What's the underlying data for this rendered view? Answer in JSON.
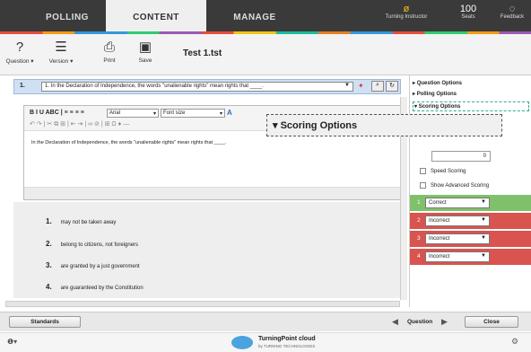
{
  "nav": {
    "tabs": [
      "POLLING",
      "CONTENT",
      "MANAGE"
    ],
    "active": "CONTENT",
    "instructor_label": "Turning Instructor",
    "seats_value": "100",
    "seats_label": "Seats",
    "feedback_label": "Feedback"
  },
  "toolbar": {
    "question": "Question",
    "version": "Version",
    "print": "Print",
    "save": "Save",
    "filename": "Test 1.tst"
  },
  "question": {
    "number": "1.",
    "text": "1. In the Declaration of Independence, the words \"unalienable rights\" mean rights that ____."
  },
  "editor": {
    "font": "Arial",
    "font_size": "Font size",
    "body": "In the Declaration of Independence, the words \"unalienable rights\" mean rights that ____."
  },
  "answers": [
    {
      "n": "1.",
      "text": "may not be taken away"
    },
    {
      "n": "2.",
      "text": "belong to citizens, not foreigners"
    },
    {
      "n": "3.",
      "text": "are granted by a just government"
    },
    {
      "n": "4.",
      "text": "are guaranteed by the Constitution"
    }
  ],
  "right": {
    "question_options": "Question Options",
    "polling_options": "Polling Options",
    "scoring_options": "Scoring Options",
    "zoom_label": "Scoring Options",
    "points_value": "0",
    "speed_scoring": "Speed Scoring",
    "show_advanced": "Show Advanced Scoring",
    "rows": [
      {
        "n": "1",
        "value": "Correct",
        "color": "#7fc16b"
      },
      {
        "n": "2",
        "value": "Incorrect",
        "color": "#d9534f"
      },
      {
        "n": "3",
        "value": "Incorrect",
        "color": "#d9534f"
      },
      {
        "n": "4",
        "value": "Incorrect",
        "color": "#d9534f"
      }
    ]
  },
  "bottom": {
    "standards": "Standards",
    "question": "Question",
    "close": "Close",
    "brand": "TurningPoint cloud",
    "brand_sub": "by TURNING TECHNOLOGIES"
  }
}
